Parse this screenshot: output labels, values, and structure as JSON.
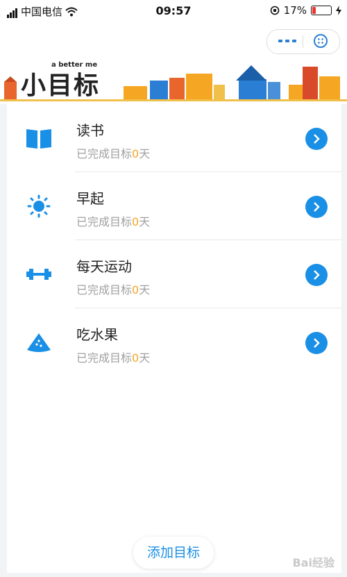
{
  "status_bar": {
    "carrier": "中国电信",
    "time": "09:57",
    "battery": "17%",
    "battery_level": 0.17
  },
  "header": {
    "logo_text": "小目标",
    "tagline": "a better me"
  },
  "goals": [
    {
      "title": "读书",
      "sub_prefix": "已完成目标",
      "count": "0",
      "sub_suffix": "天",
      "icon": "book-icon"
    },
    {
      "title": "早起",
      "sub_prefix": "已完成目标",
      "count": "0",
      "sub_suffix": "天",
      "icon": "sun-icon"
    },
    {
      "title": "每天运动",
      "sub_prefix": "已完成目标",
      "count": "0",
      "sub_suffix": "天",
      "icon": "dumbbell-icon"
    },
    {
      "title": "吃水果",
      "sub_prefix": "已完成目标",
      "count": "0",
      "sub_suffix": "天",
      "icon": "watermelon-icon"
    }
  ],
  "add_button_label": "添加目标",
  "watermark": "Bai经验",
  "colors": {
    "accent": "#1a8fe6",
    "highlight": "#f5a623",
    "muted": "#a0a0a0"
  }
}
